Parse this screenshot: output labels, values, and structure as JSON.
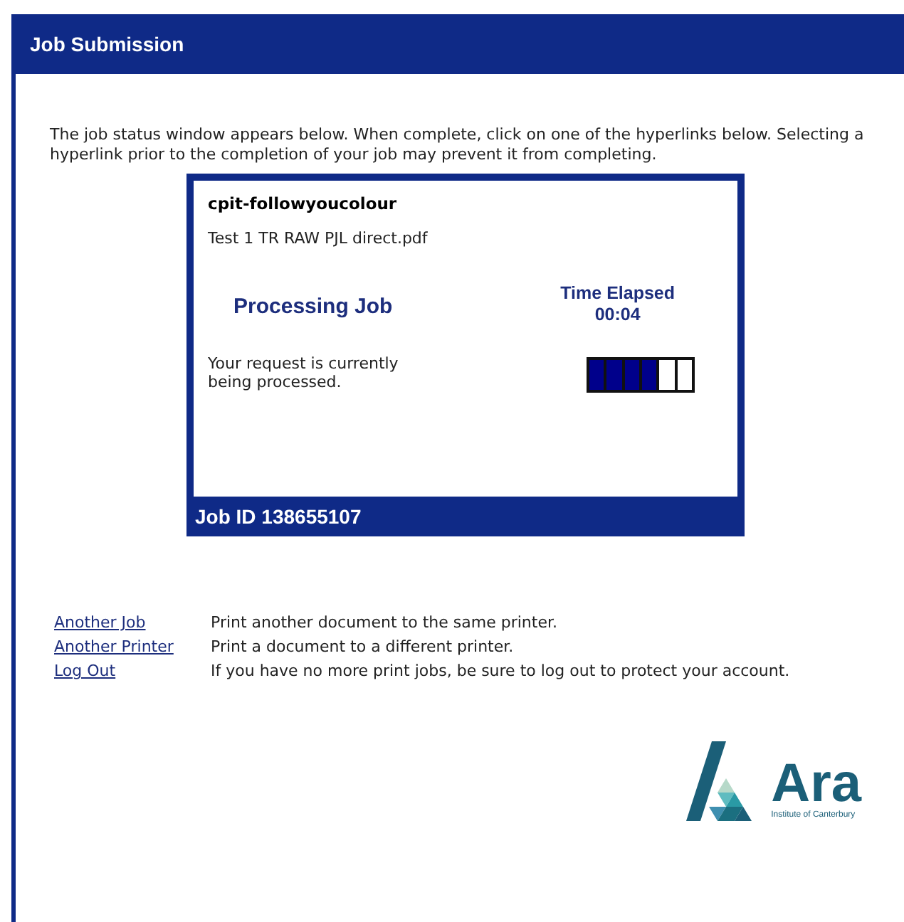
{
  "header": {
    "title": "Job Submission"
  },
  "intro": "The job status window appears below. When complete, click on one of the hyperlinks below. Selecting a hyperlink prior to the completion of your job may prevent it from completing.",
  "status_window": {
    "printer": "cpit-followyoucolour",
    "document": "Test 1 TR RAW PJL direct.pdf",
    "status": "Processing Job",
    "elapsed_label": "Time Elapsed",
    "elapsed": "00:04",
    "message": "Your request is currently being processed.",
    "progress": {
      "level": 0.667
    },
    "job_id": "Job ID 138655107"
  },
  "links": [
    {
      "label": "Another Job",
      "description": "Print another document to the same printer."
    },
    {
      "label": "Another Printer",
      "description": "Print a document to a different printer."
    },
    {
      "label": "Log Out",
      "description": "If you have no more print jobs, be sure to log out to protect your account."
    }
  ],
  "logo": {
    "name": "Ara",
    "tagline": "Institute of Canterbury"
  }
}
